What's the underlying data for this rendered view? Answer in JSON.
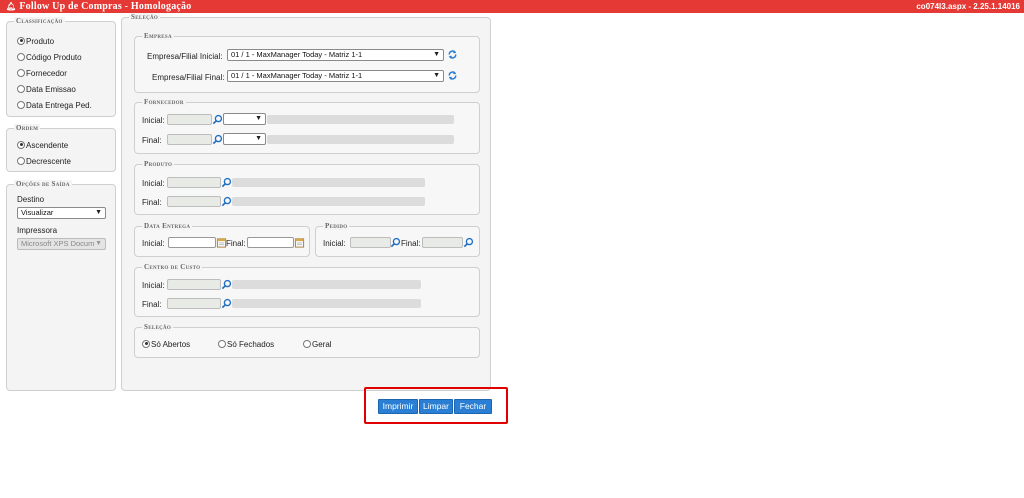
{
  "header": {
    "title": "Follow Up de Compras",
    "separator": " - ",
    "subtitle": "Homologação",
    "version": "co074l3.aspx - 2.25.1.14016",
    "bar_color": "#e53935"
  },
  "classificacao": {
    "legend": "Classificação",
    "options": [
      {
        "label": "Produto",
        "selected": true
      },
      {
        "label": "Código Produto",
        "selected": false
      },
      {
        "label": "Fornecedor",
        "selected": false
      },
      {
        "label": "Data Emissao",
        "selected": false
      },
      {
        "label": "Data Entrega Ped.",
        "selected": false
      }
    ]
  },
  "ordem": {
    "legend": "Ordem",
    "options": [
      {
        "label": "Ascendente",
        "selected": true
      },
      {
        "label": "Decrescente",
        "selected": false
      }
    ]
  },
  "saida": {
    "legend": "Opções de Saída",
    "destino_label": "Destino",
    "destino_value": "Visualizar",
    "impressora_label": "Impressora",
    "impressora_value": "Microsoft XPS Docum"
  },
  "selecao": {
    "legend": "Seleção",
    "empresa": {
      "legend": "Empresa",
      "inicial_label": "Empresa/Filial Inicial:",
      "inicial_value": "01 / 1 - MaxManager Today - Matriz 1-1",
      "final_label": "Empresa/Filial Final:",
      "final_value": "01 / 1 - MaxManager Today - Matriz 1-1"
    },
    "fornecedor": {
      "legend": "Fornecedor",
      "inicial_label": "Inicial:",
      "final_label": "Final:"
    },
    "produto": {
      "legend": "Produto",
      "inicial_label": "Inicial:",
      "final_label": "Final:"
    },
    "data_entrega": {
      "legend": "Data Entrega",
      "inicial_label": "Inicial:",
      "final_label": "Final:"
    },
    "pedido": {
      "legend": "Pedido",
      "inicial_label": "Inicial:",
      "final_label": "Final:"
    },
    "centro_custo": {
      "legend": "Centro de Custo",
      "inicial_label": "Inicial:",
      "final_label": "Final:"
    },
    "selecao_status": {
      "legend": "Seleção",
      "options": [
        {
          "label": "Só Abertos",
          "selected": true
        },
        {
          "label": "Só Fechados",
          "selected": false
        },
        {
          "label": "Geral",
          "selected": false
        }
      ]
    }
  },
  "actions": {
    "imprimir": "Imprimir",
    "limpar": "Limpar",
    "fechar": "Fechar",
    "button_color": "#2a7fd4",
    "highlight_color": "#e00000"
  }
}
